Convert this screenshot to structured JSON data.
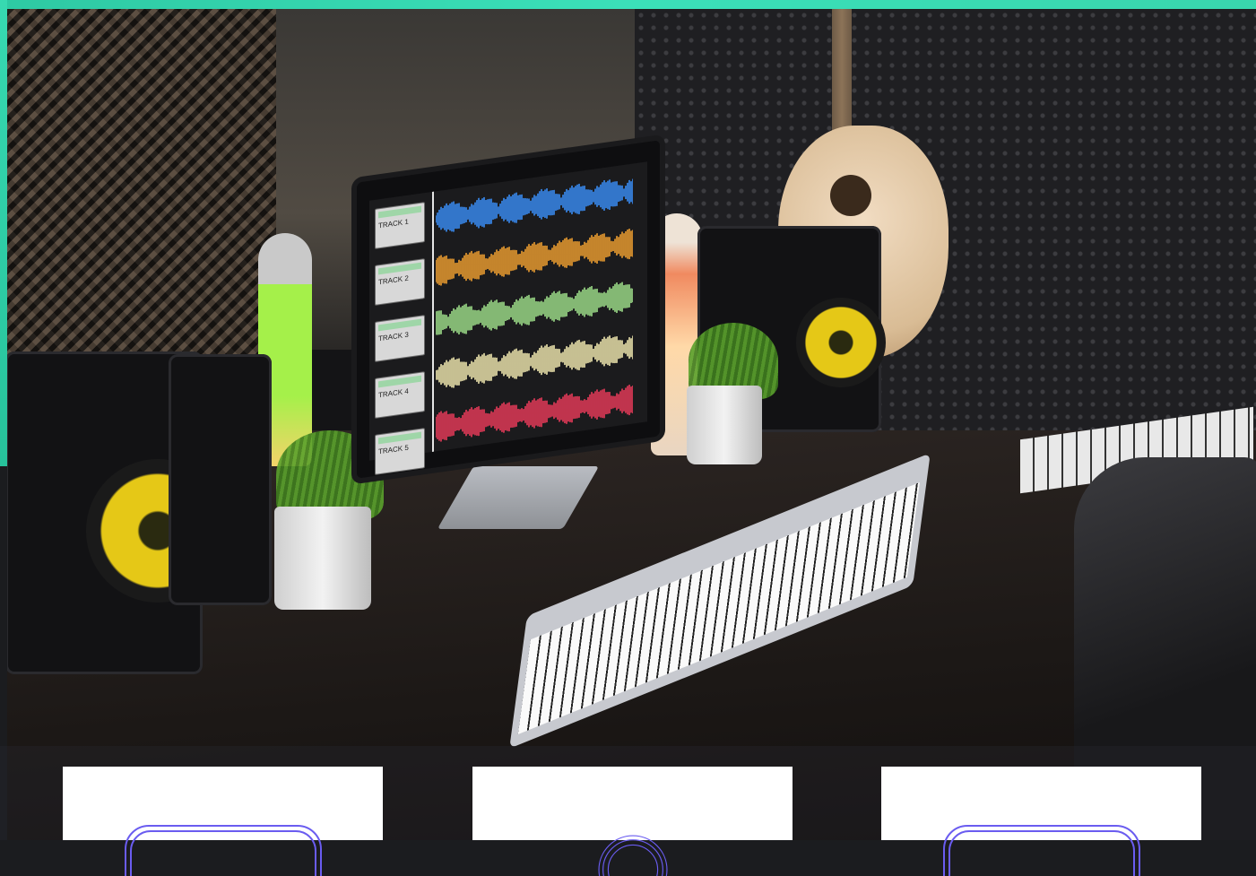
{
  "monitor": {
    "tracks": [
      {
        "label": "TRACK 1",
        "color": "#3a8ef6"
      },
      {
        "label": "TRACK 2",
        "color": "#f0a030"
      },
      {
        "label": "TRACK 3",
        "color": "#9fe08a"
      },
      {
        "label": "TRACK 4",
        "color": "#f2e9b0"
      },
      {
        "label": "TRACK 5",
        "color": "#ea3b5a"
      }
    ]
  },
  "cards": [
    {
      "icon": "rounded-square-icon"
    },
    {
      "icon": "circle-icon"
    },
    {
      "icon": "rounded-square-icon"
    }
  ],
  "colors": {
    "accent_teal": "#33d3ab",
    "card_icon_stroke": "#6a5cf0",
    "speaker_cone": "#e5c817"
  }
}
